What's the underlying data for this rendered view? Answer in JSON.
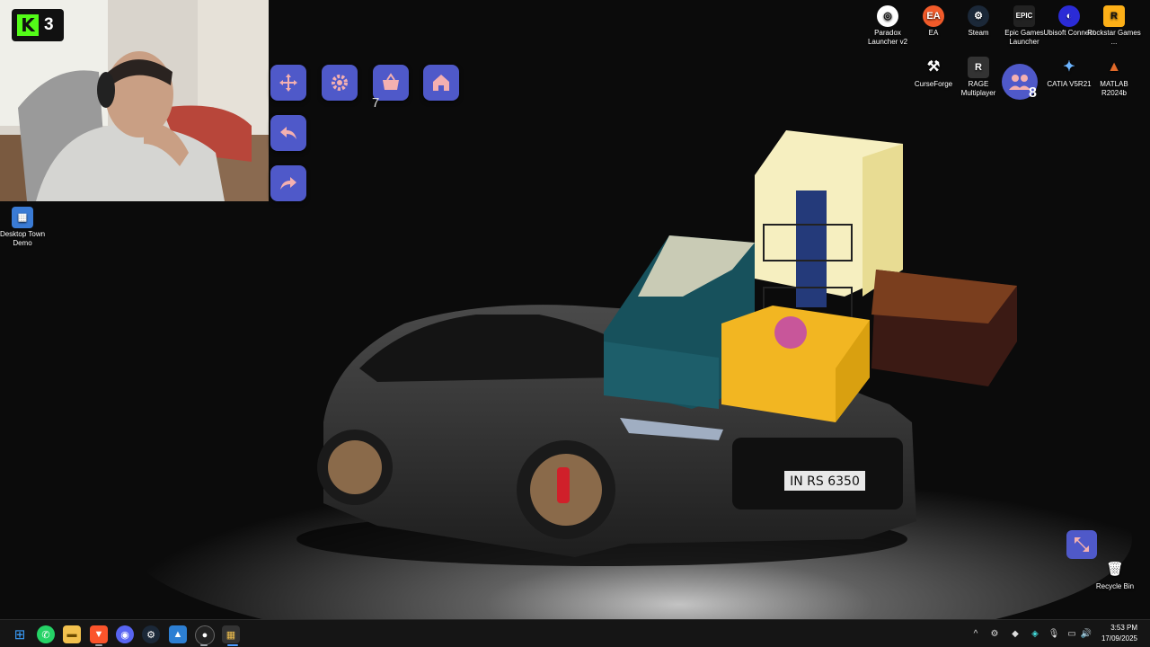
{
  "stream_overlay": {
    "platform_icon": "kick-logo-icon",
    "viewer_count": "3"
  },
  "desktop_icons": {
    "left": [
      {
        "label": "Desktop Town Demo",
        "icon": "desktop-town-icon"
      }
    ],
    "top_right_row1": [
      {
        "label": "Paradox Launcher v2",
        "icon": "paradox-icon"
      },
      {
        "label": "EA",
        "icon": "ea-icon"
      },
      {
        "label": "Steam",
        "icon": "steam-icon"
      },
      {
        "label": "Epic Games Launcher",
        "icon": "epic-games-icon"
      },
      {
        "label": "Ubisoft Connect",
        "icon": "ubisoft-icon"
      },
      {
        "label": "Rockstar Games ...",
        "icon": "rockstar-icon"
      }
    ],
    "top_right_row2": [
      {
        "label": "CurseForge",
        "icon": "curseforge-icon"
      },
      {
        "label": "RAGE Multiplayer",
        "icon": "rage-mp-icon"
      },
      {
        "label": "CATIA V5R21",
        "icon": "catia-icon"
      },
      {
        "label": "MATLAB R2024b",
        "icon": "matlab-icon"
      }
    ],
    "recycle_bin": {
      "label": "Recycle Bin",
      "icon": "recycle-bin-icon"
    }
  },
  "game_toolbar": {
    "basket_count": "7",
    "people_count": "8"
  },
  "taskbar": {
    "apps": [
      "windows-start-icon",
      "whatsapp-icon",
      "file-explorer-icon",
      "brave-icon",
      "discord-icon",
      "steam-icon",
      "photos-icon",
      "obs-icon",
      "desktop-town-icon"
    ],
    "clock_time": "3:53 PM",
    "clock_date": "17/09/2025"
  },
  "colors": {
    "tool_button": "#4f59c9",
    "kick_green": "#53fc18"
  }
}
